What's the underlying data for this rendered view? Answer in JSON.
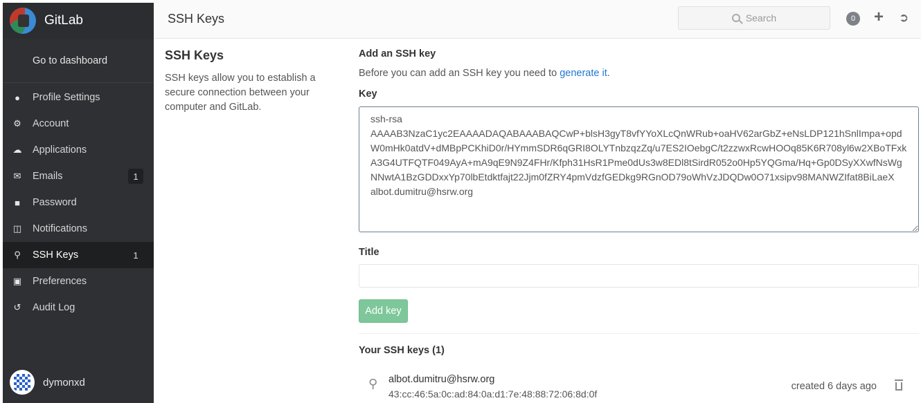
{
  "app": {
    "brand": "GitLab",
    "user": "dymonxd"
  },
  "sidebar": {
    "dashboard_link": "Go to dashboard",
    "items": [
      {
        "label": "Profile Settings",
        "icon": "user-icon",
        "badge": ""
      },
      {
        "label": "Account",
        "icon": "gear-icon",
        "badge": ""
      },
      {
        "label": "Applications",
        "icon": "cloud-icon",
        "badge": ""
      },
      {
        "label": "Emails",
        "icon": "envelope-icon",
        "badge": "1"
      },
      {
        "label": "Password",
        "icon": "lock-icon",
        "badge": ""
      },
      {
        "label": "Notifications",
        "icon": "inbox-icon",
        "badge": ""
      },
      {
        "label": "SSH Keys",
        "icon": "key-icon",
        "badge": "1",
        "active": true
      },
      {
        "label": "Preferences",
        "icon": "image-icon",
        "badge": ""
      },
      {
        "label": "Audit Log",
        "icon": "history-icon",
        "badge": ""
      }
    ]
  },
  "header": {
    "title": "SSH Keys",
    "search_placeholder": "Search",
    "todo_count": "0"
  },
  "intro": {
    "heading": "SSH Keys",
    "description": "SSH keys allow you to establish a secure connection between your computer and GitLab."
  },
  "form": {
    "heading": "Add an SSH key",
    "before_text": "Before you can add an SSH key you need to ",
    "generate_link": "generate it",
    "before_suffix": ".",
    "key_label": "Key",
    "key_value": "ssh-rsa\nAAAAB3NzaC1yc2EAAAADAQABAAABAQCwP+blsH3gyT8vfYYoXLcQnWRub+oaHV62arGbZ+eNsLDP121hSnlImpa+opdW0mHk0atdV+dMBpPCKhiD0r/HYmmSDR6qGRI8OLYTnbzqzZq/u7ES2IOebgC/t2zzwxRcwHOOq85K6R708yl6w2XBoTFxkA3G4UTFQTF049AyA+mA9qE9N9Z4FHr/Kfph31HsR1Pme0dUs3w8EDl8tSirdR052o0Hp5YQGma/Hq+Gp0DSyXXwfNsWgNNwtA1BzGDDxxYp70lbEtdktfajt22Jjm0fZRY4pmVdzfGEDkg9RGnOD79oWhVzJDQDw0O71xsipv98MANWZIfat8BiLaeX albot.dumitru@hsrw.org\n",
    "title_label": "Title",
    "title_value": "",
    "submit_label": "Add key"
  },
  "keys_section": {
    "heading": "Your SSH keys (1)",
    "keys": [
      {
        "title": "albot.dumitru@hsrw.org",
        "fingerprint": "43:cc:46:5a:0c:ad:84:0a:d1:7e:48:88:72:06:8d:0f",
        "created": "created 6 days ago"
      }
    ]
  },
  "colors": {
    "sidebar_bg": "#2e3033",
    "link": "#1f78d1",
    "button_success": "#7ec79a"
  }
}
